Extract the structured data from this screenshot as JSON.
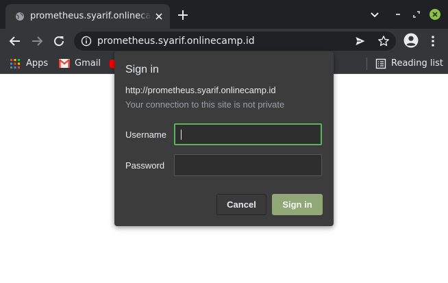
{
  "tab": {
    "title": "prometheus.syarif.onlinecamp.id",
    "favicon": "globe-icon"
  },
  "toolbar": {
    "url": "prometheus.syarif.onlinecamp.id",
    "icons": [
      "back-icon",
      "forward-icon",
      "reload-icon",
      "info-icon",
      "send-icon",
      "star-icon",
      "profile-icon",
      "menu-icon"
    ]
  },
  "bookmarks": {
    "items": [
      {
        "label": "Apps",
        "icon": "apps-grid-icon"
      },
      {
        "label": "Gmail",
        "icon": "gmail-icon"
      },
      {
        "label": "",
        "icon": "youtube-icon"
      }
    ],
    "reading_list": "Reading list"
  },
  "dialog": {
    "title": "Sign in",
    "url": "http://prometheus.syarif.onlinecamp.id",
    "note": "Your connection to this site is not private",
    "username_label": "Username",
    "username_value": "",
    "password_label": "Password",
    "password_value": "",
    "cancel_label": "Cancel",
    "signin_label": "Sign in"
  },
  "colors": {
    "tabstrip": "#202124",
    "toolbar": "#35363a",
    "dialog": "#3c3c3c",
    "focus_border": "#5ab45a",
    "signin_button": "#8fa876",
    "close_button": "#8bc34a"
  }
}
